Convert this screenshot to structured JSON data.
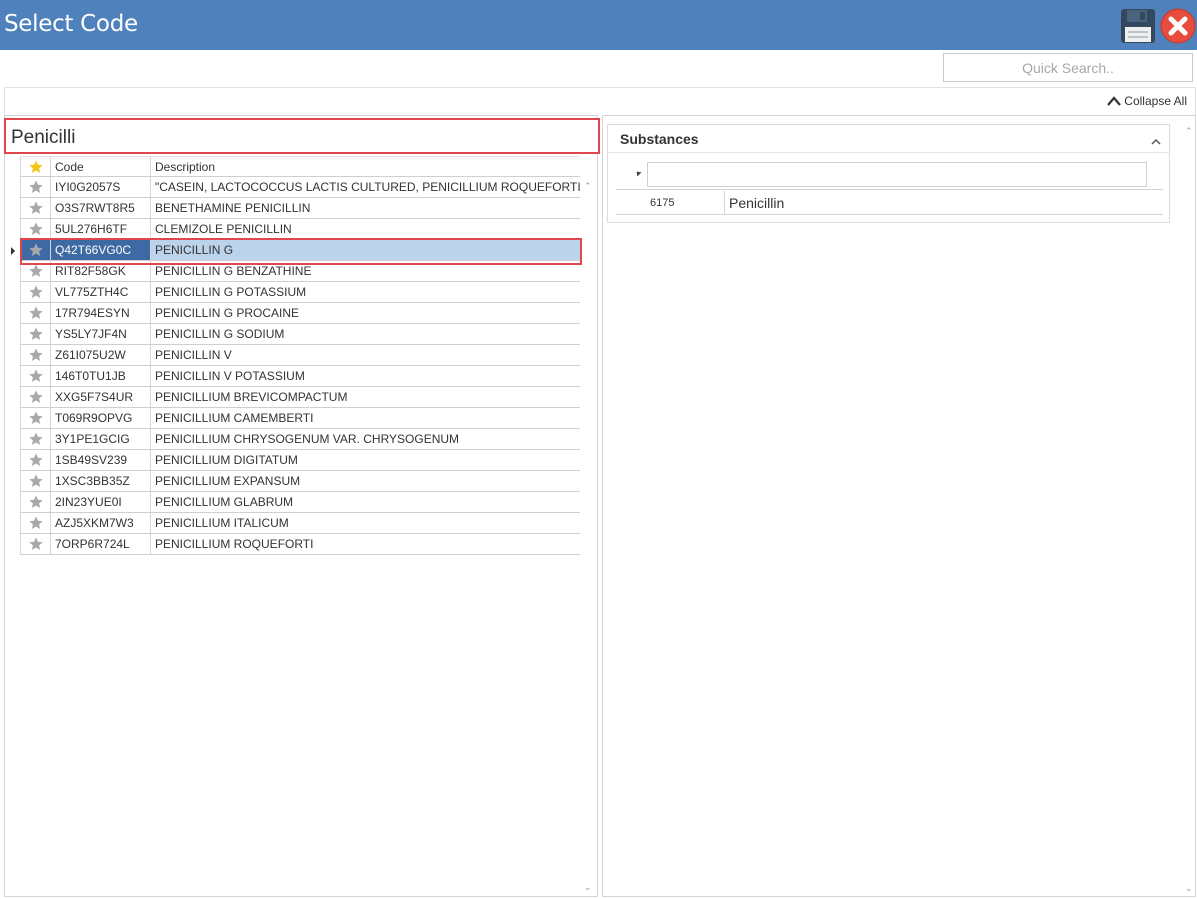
{
  "window": {
    "title": "Select Code"
  },
  "toolbar": {
    "quick_search_placeholder": "Quick Search..",
    "collapse_all_label": "Collapse All"
  },
  "search": {
    "value": "Penicilli"
  },
  "grid": {
    "columns": {
      "code": "Code",
      "description": "Description"
    },
    "rows": [
      {
        "code": "IYI0G2057S",
        "description": "\"CASEIN, LACTOCOCCUS LACTIS CULTURED, PENICILLIUM ROQUEFORTI CUL...",
        "favorite": false
      },
      {
        "code": "O3S7RWT8R5",
        "description": "BENETHAMINE PENICILLIN",
        "favorite": false
      },
      {
        "code": "5UL276H6TF",
        "description": "CLEMIZOLE PENICILLIN",
        "favorite": false
      },
      {
        "code": "Q42T66VG0C",
        "description": "PENICILLIN G",
        "favorite": false,
        "selected": true
      },
      {
        "code": "RIT82F58GK",
        "description": "PENICILLIN G BENZATHINE",
        "favorite": false
      },
      {
        "code": "VL775ZTH4C",
        "description": "PENICILLIN G POTASSIUM",
        "favorite": false
      },
      {
        "code": "17R794ESYN",
        "description": "PENICILLIN G PROCAINE",
        "favorite": false
      },
      {
        "code": "YS5LY7JF4N",
        "description": "PENICILLIN G SODIUM",
        "favorite": false
      },
      {
        "code": "Z61I075U2W",
        "description": "PENICILLIN V",
        "favorite": false
      },
      {
        "code": "146T0TU1JB",
        "description": "PENICILLIN V POTASSIUM",
        "favorite": false
      },
      {
        "code": "XXG5F7S4UR",
        "description": "PENICILLIUM BREVICOMPACTUM",
        "favorite": false
      },
      {
        "code": "T069R9OPVG",
        "description": "PENICILLIUM CAMEMBERTI",
        "favorite": false
      },
      {
        "code": "3Y1PE1GCIG",
        "description": "PENICILLIUM CHRYSOGENUM VAR. CHRYSOGENUM",
        "favorite": false
      },
      {
        "code": "1SB49SV239",
        "description": "PENICILLIUM DIGITATUM",
        "favorite": false
      },
      {
        "code": "1XSC3BB35Z",
        "description": "PENICILLIUM EXPANSUM",
        "favorite": false
      },
      {
        "code": "2IN23YUE0I",
        "description": "PENICILLIUM GLABRUM",
        "favorite": false
      },
      {
        "code": "AZJ5XKM7W3",
        "description": "PENICILLIUM ITALICUM",
        "favorite": false
      },
      {
        "code": "7ORP6R724L",
        "description": "PENICILLIUM ROQUEFORTI",
        "favorite": false
      }
    ]
  },
  "substances": {
    "title": "Substances",
    "filter_value": "",
    "rows": [
      {
        "id": "6175",
        "name": "Penicillin"
      }
    ]
  },
  "icons": {
    "save": "floppy-disk-icon",
    "close": "close-icon",
    "collapse": "chevron-up-icon",
    "favorite": "star-icon"
  },
  "colors": {
    "titlebar": "#4f81bd",
    "highlight_outline": "#e0474c",
    "selected_row": "#bcd3ec",
    "selected_cell": "#3e6aa3",
    "star_gold": "#f5c518",
    "star_gray": "#a9a9a9"
  }
}
